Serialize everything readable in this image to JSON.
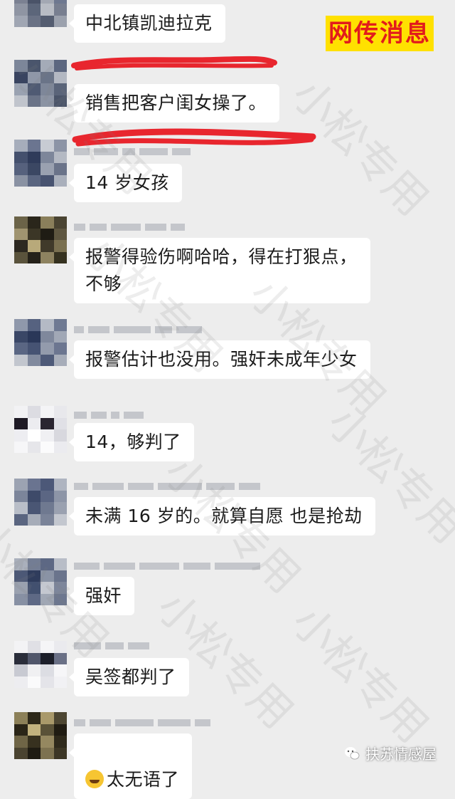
{
  "badge": "网传消息",
  "watermark": "小松专用",
  "credit": "扶苏情感屋",
  "messages": [
    {
      "text": "中北镇凯迪拉克"
    },
    {
      "text": "销售把客户闺女操了。"
    },
    {
      "text": "14 岁女孩"
    },
    {
      "text": "报警得验伤啊哈哈，得在打狠点，\n不够"
    },
    {
      "text": "报警估计也没用。强奸未成年少女"
    },
    {
      "text": "14，够判了"
    },
    {
      "text": "未满 16 岁的。就算自愿 也是抢劫"
    },
    {
      "text": "强奸"
    },
    {
      "text": "吴签都判了"
    },
    {
      "text": "太无语了",
      "emoji": "crying-laughing-emoji"
    }
  ],
  "colors": {
    "badge_text": "#e21c1c",
    "badge_bg": "#ffe100",
    "redaction": "#e8262e",
    "bubble": "#ffffff",
    "background": "#ededed"
  }
}
